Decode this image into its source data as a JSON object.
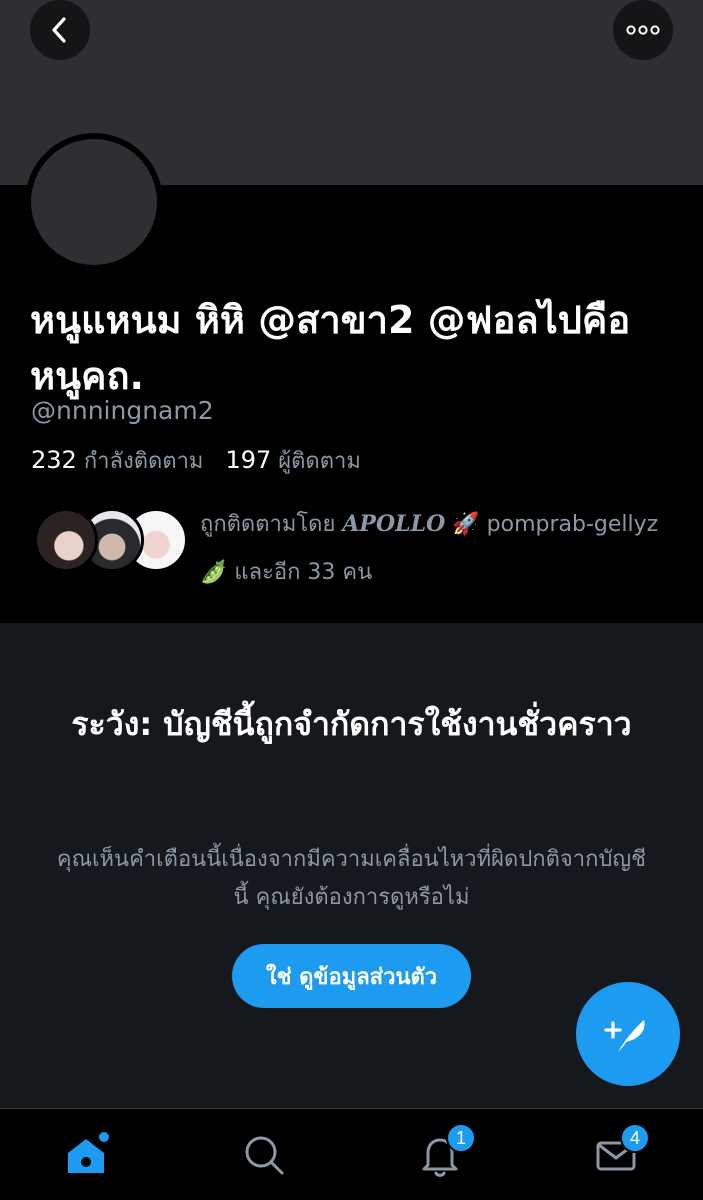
{
  "header": {
    "back_icon": "chevron-left-icon",
    "more_icon": "more-horizontal-icon"
  },
  "profile": {
    "display_name": "หนูแหนม หิหิ @สาขา2 @ฟอลไปคือหนูคถ.",
    "handle": "@nnningnam2",
    "following_count": "232",
    "following_label": "กำลังติดตาม",
    "followers_count": "197",
    "followers_label": "ผู้ติดตาม",
    "followed_by_prefix": "ถูกติดตามโดย",
    "followed_by_name1": "𝑨𝑷𝑶𝑳𝑳𝑶",
    "followed_by_emoji1": "🚀",
    "followed_by_name2": "pomprab-gellyz",
    "followed_by_emoji2": "🫛",
    "followed_by_suffix": "และอีก 33 คน"
  },
  "warning": {
    "title": "ระวัง: บัญชีนี้ถูกจำกัดการใช้งานชั่วคราว",
    "message": "คุณเห็นคำเตือนนี้เนื่องจากมีความเคลื่อนไหวที่ผิดปกติจากบัญชีนี้ คุณยังต้องการดูหรือไม่",
    "view_button": "ใช่ ดูข้อมูลส่วนตัว"
  },
  "fab": {
    "icon": "compose-feather-icon"
  },
  "tabbar": {
    "home_icon": "home-icon",
    "search_icon": "search-icon",
    "notifications_icon": "bell-icon",
    "notifications_badge": "1",
    "messages_icon": "mail-icon",
    "messages_badge": "4"
  },
  "colors": {
    "accent": "#1d9bf0",
    "background": "#000000",
    "banner": "#2d2f32",
    "warning_panel": "#15181c",
    "secondary_text": "#8b98a5"
  }
}
